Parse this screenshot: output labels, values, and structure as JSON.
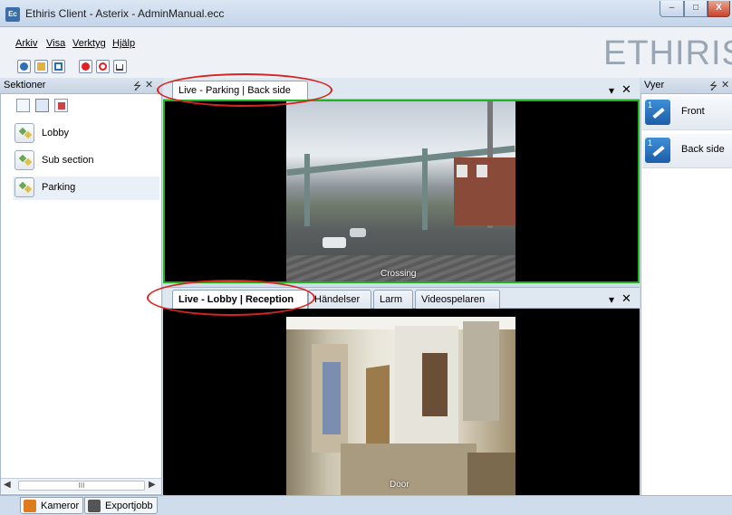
{
  "window": {
    "title": "Ethiris Client - Asterix - AdminManual.ecc",
    "app_icon": "Ec",
    "minimize_icon": "minimize-icon",
    "maximize_icon": "maximize-icon",
    "close_icon": "close-icon"
  },
  "menu": {
    "items": [
      {
        "label": "Arkiv"
      },
      {
        "label": "Visa"
      },
      {
        "label": "Verktyg"
      },
      {
        "label": "Hjälp"
      }
    ]
  },
  "logo": {
    "text": "ETHIRIS",
    "mark": "®"
  },
  "toolbar": {
    "buttons": [
      "camera-settings-icon",
      "folder-icon",
      "refresh-icon",
      "record-icon",
      "power-icon",
      "export-icon"
    ]
  },
  "left_panel": {
    "title": "Sektioner",
    "pin": "⭍",
    "close": "✕",
    "items": [
      {
        "label": "Lobby"
      },
      {
        "label": "Sub section"
      },
      {
        "label": "Parking"
      }
    ],
    "scroll_grip": "III"
  },
  "top_pane": {
    "tab_label": "Live - Parking | Back side",
    "camera_label": "Crossing",
    "border_color": "#1db51d"
  },
  "bottom_pane": {
    "tabs": [
      {
        "label": "Live - Lobby | Reception"
      },
      {
        "label": "Händelser"
      },
      {
        "label": "Larm"
      },
      {
        "label": "Videospelaren"
      }
    ],
    "camera_label": "Door"
  },
  "pane_controls": {
    "menu": "▾",
    "close": "✕"
  },
  "right_panel": {
    "title": "Vyer",
    "pin": "⭍",
    "close": "✕",
    "items": [
      {
        "label": "Front",
        "number": "1"
      },
      {
        "label": "Back side",
        "number": "1"
      }
    ]
  },
  "bottom_tabs": [
    {
      "label": "Kameror"
    },
    {
      "label": "Exportjobb"
    }
  ],
  "annotation_color": "#d8241f"
}
